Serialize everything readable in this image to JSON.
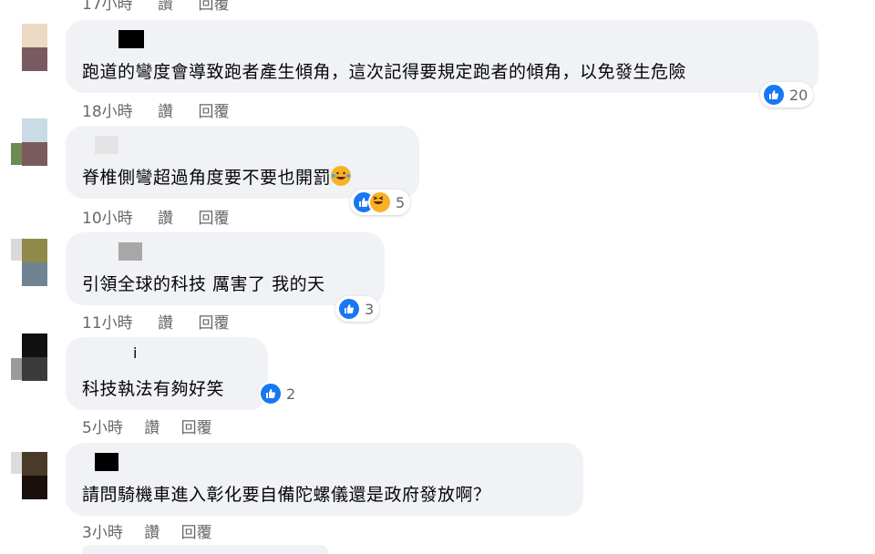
{
  "top_meta": {
    "time": "17小時",
    "read": "讚",
    "reply": "回覆"
  },
  "comments": [
    {
      "text": "跑道的彎度會導致跑者產生傾角，這次記得要規定跑者的傾角，以免發生危險",
      "time": "18小時",
      "like": "讚",
      "reply": "回覆",
      "reaction_count": "20",
      "reactions": [
        "like-icon"
      ]
    },
    {
      "text": "脊椎側彎超過角度要不要也開罰",
      "time": "10小時",
      "like": "讚",
      "reply": "回覆",
      "reaction_count": "5",
      "reactions": [
        "like-icon",
        "haha-icon"
      ]
    },
    {
      "text": "引領全球的科技 厲害了 我的天",
      "time": "11小時",
      "like": "讚",
      "reply": "回覆",
      "reaction_count": "3",
      "reactions": [
        "like-icon"
      ]
    },
    {
      "text": "科技執法有夠好笑",
      "time": "5小時",
      "like": "讚",
      "reply": "回覆",
      "reaction_count": "2",
      "reactions": [
        "like-icon"
      ],
      "name_mark": "i"
    },
    {
      "text": "請問騎機車進入彰化要自備陀螺儀還是政府發放啊？",
      "time": "3小時",
      "like": "讚",
      "reply": "回覆"
    }
  ],
  "colors": {
    "bubble": "#f0f2f5",
    "meta_text": "#65676b",
    "like_blue": "#1877f2",
    "haha_yellow": "#f7b125"
  }
}
